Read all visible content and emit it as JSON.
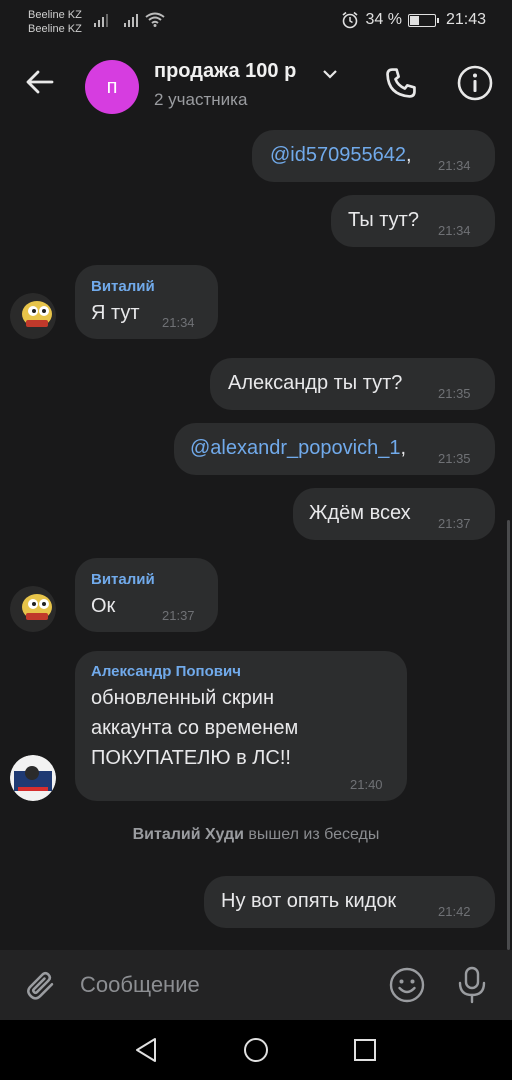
{
  "status_bar": {
    "carrier1": "Beeline KZ",
    "carrier2": "Beeline KZ",
    "battery": "34 %",
    "battery_level": 0.34,
    "time": "21:43"
  },
  "header": {
    "avatar_letter": "п",
    "title": "продажа 100 р",
    "subtitle": "2 участника",
    "avatar_color": "#d63de0"
  },
  "messages": [
    {
      "mention": "@id570955642",
      "suffix": ",",
      "time": "21:34"
    },
    {
      "text": "Ты тут?",
      "time": "21:34"
    },
    {
      "author": "Виталий",
      "text": "Я  тут",
      "time": "21:34"
    },
    {
      "text": "Александр ты тут?",
      "time": "21:35"
    },
    {
      "mention": "@alexandr_popovich_1",
      "suffix": ",",
      "time": "21:35"
    },
    {
      "text": "Ждём всех",
      "time": "21:37"
    },
    {
      "author": "Виталий",
      "text": "Ок",
      "time": "21:37"
    },
    {
      "author": "Александр Попович",
      "lines": [
        "обновленный скрин",
        "аккаунта со временем",
        "ПОКУПАТЕЛЮ в ЛС!!"
      ],
      "time": "21:40"
    },
    {
      "text": "Ну вот опять кидок",
      "time": "21:42"
    }
  ],
  "system_message": {
    "name": "Виталий Худи",
    "action": "вышел из беседы"
  },
  "composer": {
    "placeholder": "Сообщение"
  },
  "colors": {
    "background": "#19191a",
    "bubble": "#2c2d2e",
    "link": "#71aaeb"
  }
}
